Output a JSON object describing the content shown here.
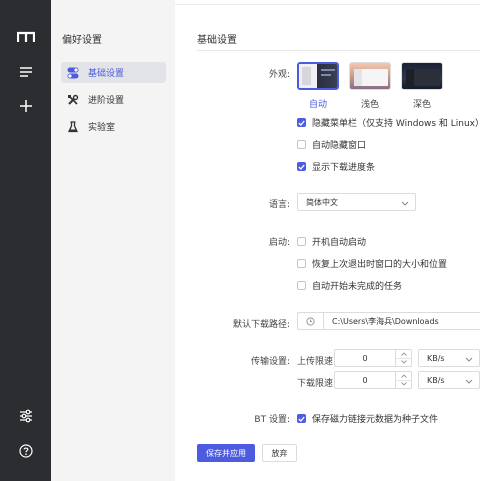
{
  "rail": {
    "icons": [
      "logo-m-icon",
      "menu-lines-icon",
      "plus-icon",
      "sliders-icon",
      "help-icon"
    ]
  },
  "nav": {
    "title": "偏好设置",
    "items": [
      {
        "label": "基础设置",
        "icon": "toggle-icon",
        "active": true
      },
      {
        "label": "进阶设置",
        "icon": "tools-icon",
        "active": false
      },
      {
        "label": "实验室",
        "icon": "flask-icon",
        "active": false
      }
    ]
  },
  "main": {
    "title": "基础设置",
    "appearance": {
      "label": "外观:",
      "themes": [
        {
          "label": "自动",
          "selected": true
        },
        {
          "label": "浅色",
          "selected": false
        },
        {
          "label": "深色",
          "selected": false
        }
      ],
      "options": [
        {
          "label": "隐藏菜单栏（仅支持 Windows 和 Linux）",
          "checked": true
        },
        {
          "label": "自动隐藏窗口",
          "checked": false
        },
        {
          "label": "显示下载进度条",
          "checked": true
        }
      ]
    },
    "language": {
      "label": "语言:",
      "value": "简体中文"
    },
    "startup": {
      "label": "启动:",
      "options": [
        {
          "label": "开机自动启动",
          "checked": false
        },
        {
          "label": "恢复上次退出时窗口的大小和位置",
          "checked": false
        },
        {
          "label": "自动开始未完成的任务",
          "checked": false
        }
      ]
    },
    "download_path": {
      "label": "默认下载路径:",
      "value": "C:\\Users\\李海兵\\Downloads"
    },
    "transfer": {
      "label": "传输设置:",
      "upload_label": "上传限速",
      "upload_value": "0",
      "upload_unit": "KB/s",
      "download_label": "下载限速",
      "download_value": "0",
      "download_unit": "KB/s"
    },
    "bt": {
      "label": "BT 设置:",
      "option": {
        "label": "保存磁力链接元数据为种子文件",
        "checked": true
      }
    },
    "buttons": {
      "save": "保存并应用",
      "discard": "放弃"
    }
  },
  "colors": {
    "accent": "#4c5be0",
    "rail": "#2b2d30",
    "nav_bg": "#f4f4f5"
  }
}
